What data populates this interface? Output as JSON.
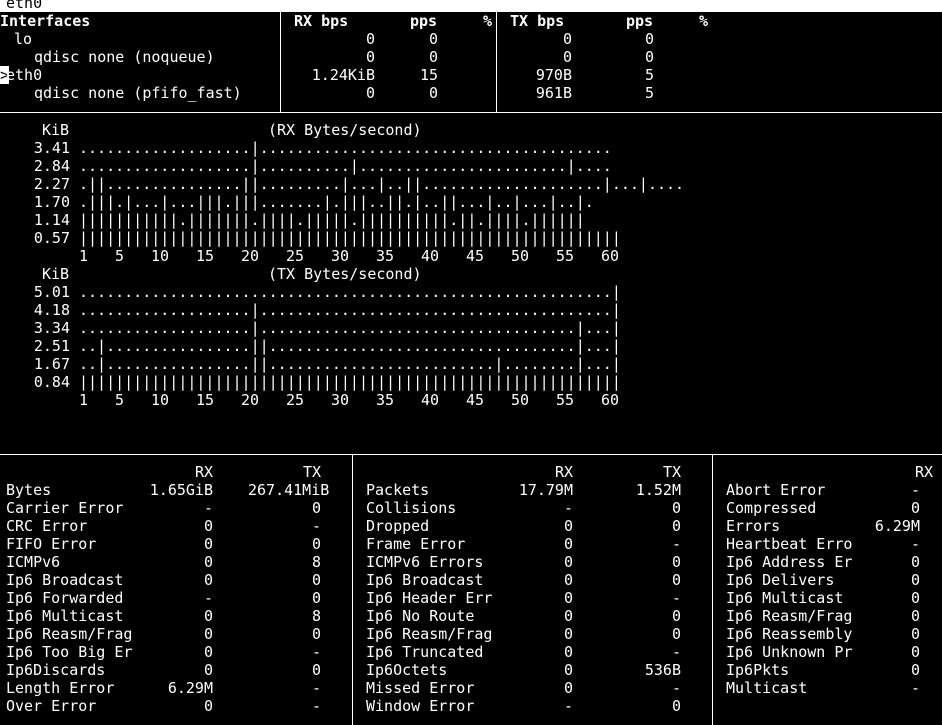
{
  "window_title": "eth0",
  "interfaces": {
    "header": {
      "name": "Interfaces",
      "rx_bps": "RX bps",
      "rx_pps": "pps",
      "rx_pct": "%",
      "tx_bps": "TX bps",
      "tx_pps": "pps",
      "tx_pct": "%"
    },
    "rows": [
      {
        "name": "lo",
        "selector": "",
        "rx_bps": "0",
        "rx_pps": "0",
        "tx_bps": "0",
        "tx_pps": "0"
      },
      {
        "name": "qdisc none (noqueue)",
        "selector": "",
        "rx_bps": "0",
        "rx_pps": "0",
        "tx_bps": "0",
        "tx_pps": "0"
      },
      {
        "name": "eth0",
        "selector": ">",
        "rx_bps": "1.24KiB",
        "rx_pps": "15",
        "tx_bps": "970B",
        "tx_pps": "5"
      },
      {
        "name": "qdisc none (pfifo_fast)",
        "selector": "",
        "rx_bps": "0",
        "rx_pps": "0",
        "tx_bps": "961B",
        "tx_pps": "5"
      }
    ]
  },
  "rx_graph": {
    "unit": "KiB",
    "title": "(RX Bytes/second)",
    "levels": [
      3.41,
      2.84,
      2.27,
      1.7,
      1.14,
      0.57
    ],
    "level_labels": [
      "3.41",
      "2.84",
      "2.27",
      "1.70",
      "1.14",
      "0.57"
    ],
    "ticks": [
      "1",
      "5",
      "10",
      "15",
      "20",
      "25",
      "30",
      "35",
      "40",
      "45",
      "50",
      "55",
      "60"
    ],
    "rows": [
      "...................|.......................................",
      "...................|..........|.......................|....",
      ".||...............||.........|...|..||....................|...|....",
      ".|||.|...|...|||.|||.......|.|||..||.|..||...|..|...|..|.",
      "|||||||||||.|||||||.||||.|||||.||||||||||.||.||||.||||||",
      "||||||||||||||||||||||||||||||||||||||||||||||||||||||||||||"
    ]
  },
  "tx_graph": {
    "unit": "KiB",
    "title": "(TX Bytes/second)",
    "levels": [
      5.01,
      4.18,
      3.34,
      2.51,
      1.67,
      0.84
    ],
    "level_labels": [
      "5.01",
      "4.18",
      "3.34",
      "2.51",
      "1.67",
      "0.84"
    ],
    "ticks": [
      "1",
      "5",
      "10",
      "15",
      "20",
      "25",
      "30",
      "35",
      "40",
      "45",
      "50",
      "55",
      "60"
    ],
    "rows": [
      "...........................................................|",
      "...................|.......................................|",
      "...................|...................................|...|",
      "..|................||..................................|...|",
      "..|................||.........................|........|...|",
      "||||||||||||||||||||||||||||||||||||||||||||||||||||||||||||"
    ]
  },
  "stats": {
    "col1": {
      "rx_header": "RX",
      "tx_header": "TX",
      "rows": [
        {
          "label": "Bytes",
          "rx": "1.65GiB",
          "tx": "267.41MiB"
        },
        {
          "label": "Carrier Error",
          "rx": "-",
          "tx": "0"
        },
        {
          "label": "CRC Error",
          "rx": "0",
          "tx": "-"
        },
        {
          "label": "FIFO Error",
          "rx": "0",
          "tx": "0"
        },
        {
          "label": "ICMPv6",
          "rx": "0",
          "tx": "8"
        },
        {
          "label": "Ip6 Broadcast",
          "rx": "0",
          "tx": "0"
        },
        {
          "label": "Ip6 Forwarded",
          "rx": "-",
          "tx": "0"
        },
        {
          "label": "Ip6 Multicast",
          "rx": "0",
          "tx": "8"
        },
        {
          "label": "Ip6 Reasm/Frag",
          "rx": "0",
          "tx": "0"
        },
        {
          "label": "Ip6 Too Big Er",
          "rx": "0",
          "tx": "-"
        },
        {
          "label": "Ip6Discards",
          "rx": "0",
          "tx": "0"
        },
        {
          "label": "Length Error",
          "rx": "6.29M",
          "tx": "-"
        },
        {
          "label": "Over Error",
          "rx": "0",
          "tx": "-"
        }
      ]
    },
    "col2": {
      "rx_header": "RX",
      "tx_header": "TX",
      "rows": [
        {
          "label": "Packets",
          "rx": "17.79M",
          "tx": "1.52M"
        },
        {
          "label": "Collisions",
          "rx": "-",
          "tx": "0"
        },
        {
          "label": "Dropped",
          "rx": "0",
          "tx": "0"
        },
        {
          "label": "Frame Error",
          "rx": "0",
          "tx": "-"
        },
        {
          "label": "ICMPv6 Errors",
          "rx": "0",
          "tx": "0"
        },
        {
          "label": "Ip6 Broadcast",
          "rx": "0",
          "tx": "0"
        },
        {
          "label": "Ip6 Header Err",
          "rx": "0",
          "tx": "-"
        },
        {
          "label": "Ip6 No Route",
          "rx": "0",
          "tx": "0"
        },
        {
          "label": "Ip6 Reasm/Frag",
          "rx": "0",
          "tx": "0"
        },
        {
          "label": "Ip6 Truncated",
          "rx": "0",
          "tx": "-"
        },
        {
          "label": "Ip6Octets",
          "rx": "0",
          "tx": "536B"
        },
        {
          "label": "Missed Error",
          "rx": "0",
          "tx": "-"
        },
        {
          "label": "Window Error",
          "rx": "-",
          "tx": "0"
        }
      ]
    },
    "col3": {
      "rx_header": "RX",
      "rows": [
        {
          "label": "Abort Error",
          "rx": "-"
        },
        {
          "label": "Compressed",
          "rx": "0"
        },
        {
          "label": "Errors",
          "rx": "6.29M"
        },
        {
          "label": "Heartbeat Erro",
          "rx": "-"
        },
        {
          "label": "Ip6 Address Er",
          "rx": "0"
        },
        {
          "label": "Ip6 Delivers",
          "rx": "0"
        },
        {
          "label": "Ip6 Multicast",
          "rx": "0"
        },
        {
          "label": "Ip6 Reasm/Frag",
          "rx": "0"
        },
        {
          "label": "Ip6 Reassembly",
          "rx": "0"
        },
        {
          "label": "Ip6 Unknown Pr",
          "rx": "0"
        },
        {
          "label": "Ip6Pkts",
          "rx": "0"
        },
        {
          "label": "Multicast",
          "rx": "-"
        }
      ]
    }
  }
}
